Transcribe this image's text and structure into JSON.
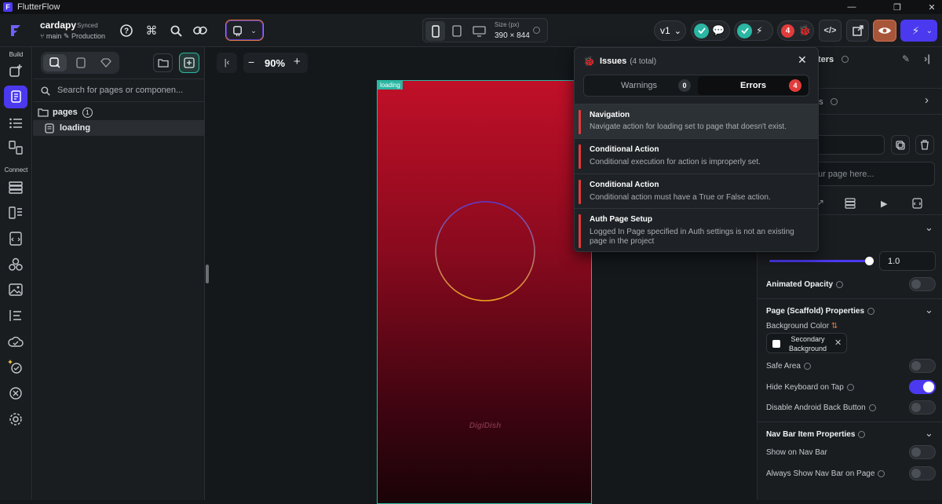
{
  "app": {
    "title": "FlutterFlow"
  },
  "project": {
    "name": "cardapy",
    "sync_status": "Synced",
    "branch": "main",
    "environment": "Production"
  },
  "device": {
    "size_label": "Size (px)",
    "size_value": "390 × 844"
  },
  "version": {
    "label": "v1"
  },
  "errors_count": "4",
  "left_rail": {
    "build_label": "Build",
    "connect_label": "Connect"
  },
  "pages_panel": {
    "search_placeholder": "Search for pages or componen...",
    "folder_label": "pages",
    "folder_count": "1",
    "page_item": "loading"
  },
  "canvas": {
    "zoom": "90%",
    "page_tag": "loading",
    "watermark": "DigiDish"
  },
  "issues": {
    "title": "Issues",
    "total": "(4 total)",
    "tabs": {
      "warnings": "Warnings",
      "warnings_count": "0",
      "errors": "Errors",
      "errors_count": "4"
    },
    "items": [
      {
        "title": "Navigation",
        "desc": "Navigate action for loading set to page that doesn't exist."
      },
      {
        "title": "Conditional Action",
        "desc": "Conditional execution for action is improperly set."
      },
      {
        "title": "Conditional Action",
        "desc": "Conditional action must have a True or False action."
      },
      {
        "title": "Auth Page Setup",
        "desc": "Logged In Page specified in Auth settings is not an existing page in the project"
      }
    ]
  },
  "right_panel": {
    "header_partial": "ters",
    "section2_partial": "gs",
    "desc_placeholder": "ur page here...",
    "opacity_value": "1.0",
    "animated_opacity": "Animated Opacity",
    "scaffold_title": "Page (Scaffold) Properties",
    "bg_color_label": "Background Color",
    "bg_color_value": "Secondary Background",
    "safe_area": "Safe Area",
    "hide_keyboard": "Hide Keyboard on Tap",
    "disable_back": "Disable Android Back Button",
    "navbar_title": "Nav Bar Item Properties",
    "show_nav": "Show on Nav Bar",
    "always_show_nav": "Always Show Nav Bar on Page",
    "hide_keyboard_on": 1
  },
  "colors": {
    "accent": "#4b39ef",
    "error": "#e13c3c",
    "success": "#2bb7a3",
    "phone_top": "#c01028",
    "phone_bottom": "#1a0307"
  }
}
